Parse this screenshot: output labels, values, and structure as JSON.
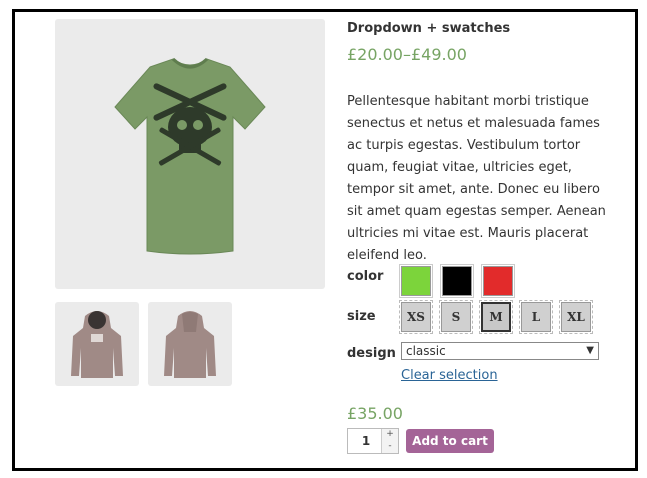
{
  "product": {
    "title": "Dropdown + swatches",
    "price_range": "£20.00–£49.00",
    "description": "Pellentesque habitant morbi tristique senectus et netus et malesuada fames ac turpis egestas. Vestibulum tortor quam, feugiat vitae, ultricies eget, tempor sit amet, ante. Donec eu libero sit amet quam egestas semper. Aenean ultricies mi vitae est. Mauris placerat eleifend leo.",
    "price": "£35.00"
  },
  "colors": {
    "price": "#77a464",
    "button": "#a46497",
    "shirt": "#7b9a66"
  },
  "color_option": {
    "label": "color",
    "swatches": [
      {
        "name": "green",
        "hex": "#7cd43b"
      },
      {
        "name": "black",
        "hex": "#000000"
      },
      {
        "name": "red",
        "hex": "#e22b2b"
      }
    ]
  },
  "size_option": {
    "label": "size",
    "options": [
      "XS",
      "S",
      "M",
      "L",
      "XL"
    ],
    "selected": "M"
  },
  "design_option": {
    "label": "design",
    "selected": "classic",
    "clear_label": "Clear selection"
  },
  "cart": {
    "quantity": "1",
    "plus": "+",
    "minus": "-",
    "add_label": "Add to cart"
  }
}
